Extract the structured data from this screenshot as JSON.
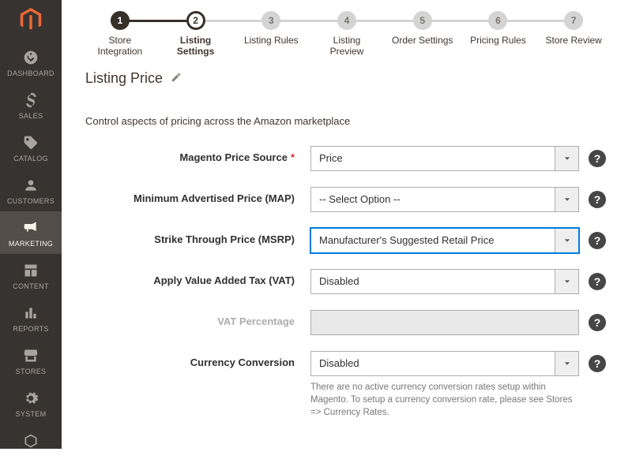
{
  "sidebar": {
    "items": [
      {
        "label": "DASHBOARD"
      },
      {
        "label": "SALES"
      },
      {
        "label": "CATALOG"
      },
      {
        "label": "CUSTOMERS"
      },
      {
        "label": "MARKETING"
      },
      {
        "label": "CONTENT"
      },
      {
        "label": "REPORTS"
      },
      {
        "label": "STORES"
      },
      {
        "label": "SYSTEM"
      }
    ]
  },
  "stepper": {
    "steps": [
      {
        "num": "1",
        "label": "Store Integration"
      },
      {
        "num": "2",
        "label": "Listing Settings"
      },
      {
        "num": "3",
        "label": "Listing Rules"
      },
      {
        "num": "4",
        "label": "Listing Preview"
      },
      {
        "num": "5",
        "label": "Order Settings"
      },
      {
        "num": "6",
        "label": "Pricing Rules"
      },
      {
        "num": "7",
        "label": "Store Review"
      }
    ]
  },
  "section": {
    "title": "Listing Price",
    "description": "Control aspects of pricing across the Amazon marketplace"
  },
  "form": {
    "price_source": {
      "label": "Magento Price Source",
      "value": "Price"
    },
    "map": {
      "label": "Minimum Advertised Price (MAP)",
      "value": "-- Select Option --"
    },
    "msrp": {
      "label": "Strike Through Price (MSRP)",
      "value": "Manufacturer's Suggested Retail Price"
    },
    "vat": {
      "label": "Apply Value Added Tax (VAT)",
      "value": "Disabled"
    },
    "vat_pct": {
      "label": "VAT Percentage"
    },
    "currency": {
      "label": "Currency Conversion",
      "value": "Disabled",
      "hint": "There are no active currency conversion rates setup within Magento. To setup a currency conversion rate, please see Stores => Currency Rates."
    }
  },
  "help_glyph": "?"
}
